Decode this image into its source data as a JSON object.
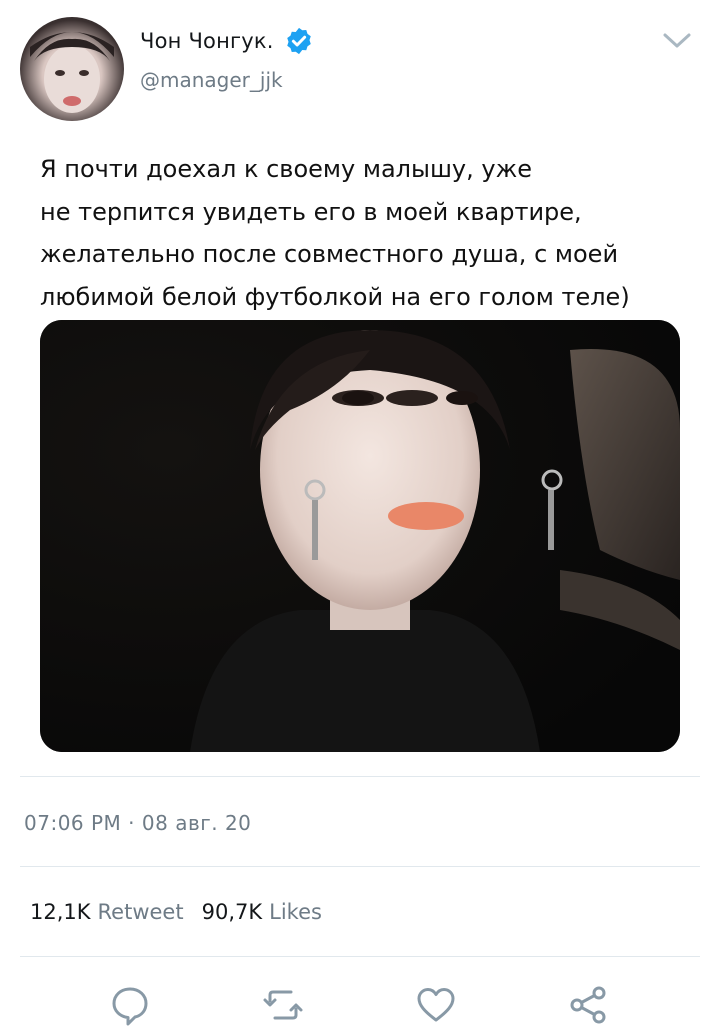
{
  "author": {
    "display_name": "Чон Чонгук.",
    "handle": "@manager_jjk",
    "verified": true,
    "avatar_icon": "profile-photo"
  },
  "tweet": {
    "text": "Я почти доехал к своему малышу, уже\nне терпится увидеть его в моей квартире,\nжелательно после совместного душа, с моей\nлюбимой белой футболкой на его голом теле)",
    "media_icon": "selfie-photo",
    "timestamp": "07:06 PM · 08 авг. 20"
  },
  "stats": {
    "retweets_count": "12,1K",
    "retweets_label": "Retweet",
    "likes_count": "90,7K",
    "likes_label": "Likes"
  },
  "actions": {
    "reply_icon": "comment-icon",
    "retweet_icon": "retweet-icon",
    "like_icon": "heart-icon",
    "share_icon": "share-icon"
  },
  "colors": {
    "verified": "#1da1f2",
    "secondary_text": "#6e7b86",
    "divider": "#e1e8ed",
    "icon": "#8899a6"
  }
}
